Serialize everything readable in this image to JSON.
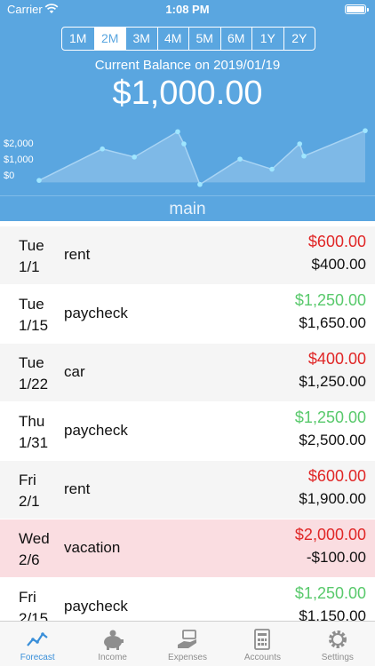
{
  "status": {
    "carrier": "Carrier",
    "time": "1:08 PM"
  },
  "range": {
    "options": [
      "1M",
      "2M",
      "3M",
      "4M",
      "5M",
      "6M",
      "1Y",
      "2Y"
    ],
    "selected": "2M"
  },
  "balance": {
    "label": "Current Balance on 2019/01/19",
    "value": "$1,000.00"
  },
  "chart_data": {
    "type": "area",
    "y_tick_labels": [
      "$2,000",
      "$1,000",
      "$0"
    ],
    "x": [
      "2019/01/19",
      "1/1",
      "1/15",
      "1/22",
      "1/31",
      "2/1",
      "2/6",
      "2/15",
      "2/22",
      "2/28",
      "3/1",
      "3/15"
    ],
    "values": [
      100,
      1650,
      1250,
      2500,
      1900,
      -100,
      1150,
      650,
      1900,
      1300,
      2550
    ],
    "ylim": [
      -200,
      2600
    ],
    "grid": false
  },
  "account": "main",
  "transactions": [
    {
      "weekday": "Tue",
      "date": "1/1",
      "payee": "rent",
      "amount": "$600.00",
      "direction": "out",
      "balance": "$400.00",
      "style": "gray"
    },
    {
      "weekday": "Tue",
      "date": "1/15",
      "payee": "paycheck",
      "amount": "$1,250.00",
      "direction": "in",
      "balance": "$1,650.00",
      "style": "white"
    },
    {
      "weekday": "Tue",
      "date": "1/22",
      "payee": "car",
      "amount": "$400.00",
      "direction": "out",
      "balance": "$1,250.00",
      "style": "gray"
    },
    {
      "weekday": "Thu",
      "date": "1/31",
      "payee": "paycheck",
      "amount": "$1,250.00",
      "direction": "in",
      "balance": "$2,500.00",
      "style": "white"
    },
    {
      "weekday": "Fri",
      "date": "2/1",
      "payee": "rent",
      "amount": "$600.00",
      "direction": "out",
      "balance": "$1,900.00",
      "style": "gray"
    },
    {
      "weekday": "Wed",
      "date": "2/6",
      "payee": "vacation",
      "amount": "$2,000.00",
      "direction": "out",
      "balance": "-$100.00",
      "style": "alert"
    },
    {
      "weekday": "Fri",
      "date": "2/15",
      "payee": "paycheck",
      "amount": "$1,250.00",
      "direction": "in",
      "balance": "$1,150.00",
      "style": "white"
    }
  ],
  "tabs": [
    {
      "label": "Forecast",
      "icon": "trend-chart-icon",
      "active": true
    },
    {
      "label": "Income",
      "icon": "piggy-bank-icon",
      "active": false
    },
    {
      "label": "Expenses",
      "icon": "money-hand-icon",
      "active": false
    },
    {
      "label": "Accounts",
      "icon": "ledger-icon",
      "active": false
    },
    {
      "label": "Settings",
      "icon": "gear-icon",
      "active": false
    }
  ],
  "colors": {
    "header": "#5aa6e0",
    "expense": "#e02626",
    "income": "#58c96b",
    "alert_row": "#fadde1",
    "active_tab": "#3a8fd9"
  }
}
